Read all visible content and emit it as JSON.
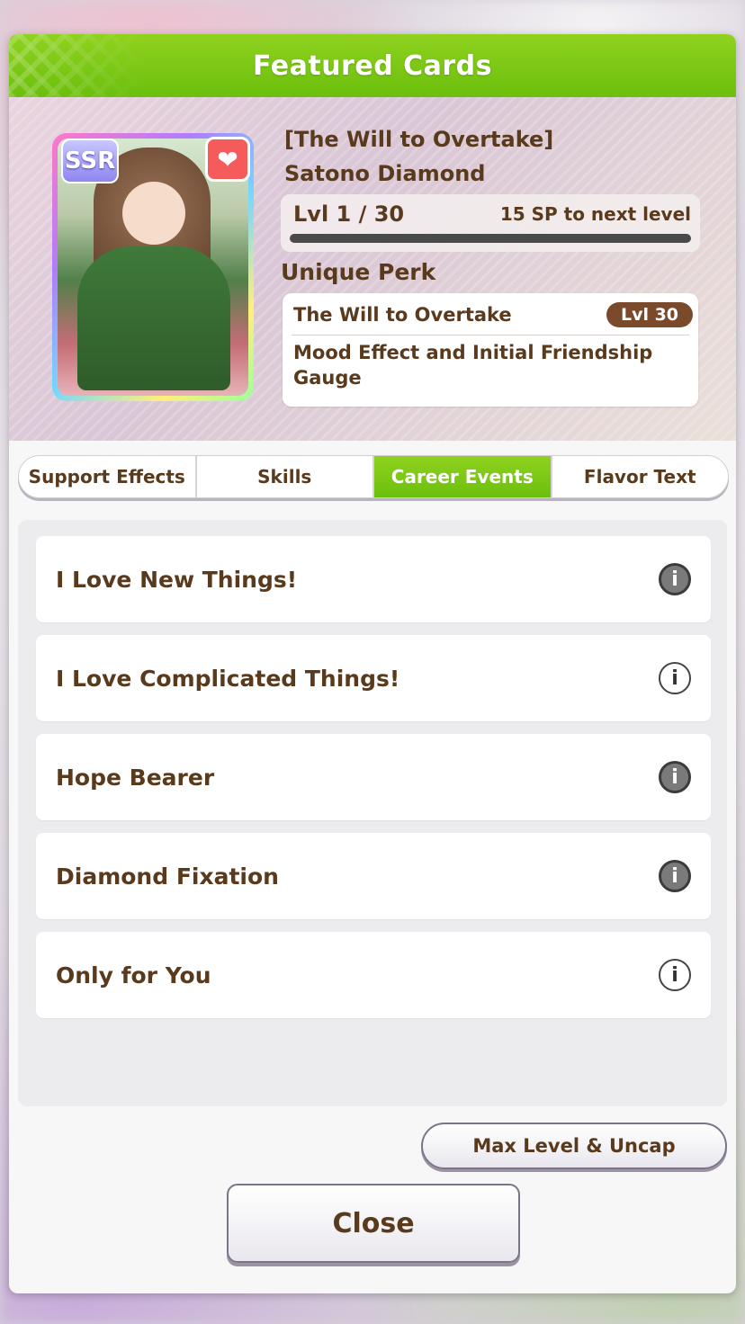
{
  "header": {
    "title": "Featured Cards"
  },
  "card": {
    "rarity": "SSR",
    "favorite_icon": "heart-icon",
    "title_line1": "[The Will to Overtake]",
    "title_line2": "Satono Diamond",
    "level": "Lvl 1 / 30",
    "sp_text": "15 SP to next level",
    "level_progress": 0
  },
  "perk": {
    "label": "Unique Perk",
    "name": "The Will to Overtake",
    "level_badge": "Lvl  30",
    "description": "Mood Effect and Initial Friendship Gauge"
  },
  "tabs": [
    {
      "label": "Support Effects",
      "active": false
    },
    {
      "label": "Skills",
      "active": false
    },
    {
      "label": "Career Events",
      "active": true
    },
    {
      "label": "Flavor Text",
      "active": false
    }
  ],
  "events": [
    {
      "name": "I Love New Things!",
      "icon": "info-filled-icon"
    },
    {
      "name": "I Love Complicated Things!",
      "icon": "info-outline-icon"
    },
    {
      "name": "Hope Bearer",
      "icon": "info-filled-icon"
    },
    {
      "name": "Diamond Fixation",
      "icon": "info-filled-icon"
    },
    {
      "name": "Only for You",
      "icon": "info-outline-icon"
    }
  ],
  "buttons": {
    "max_level": "Max Level & Uncap",
    "close": "Close"
  },
  "colors": {
    "accent_green": "#8fd21f",
    "text_brown": "#5a3a1d",
    "perk_badge": "#7b4a2b"
  }
}
